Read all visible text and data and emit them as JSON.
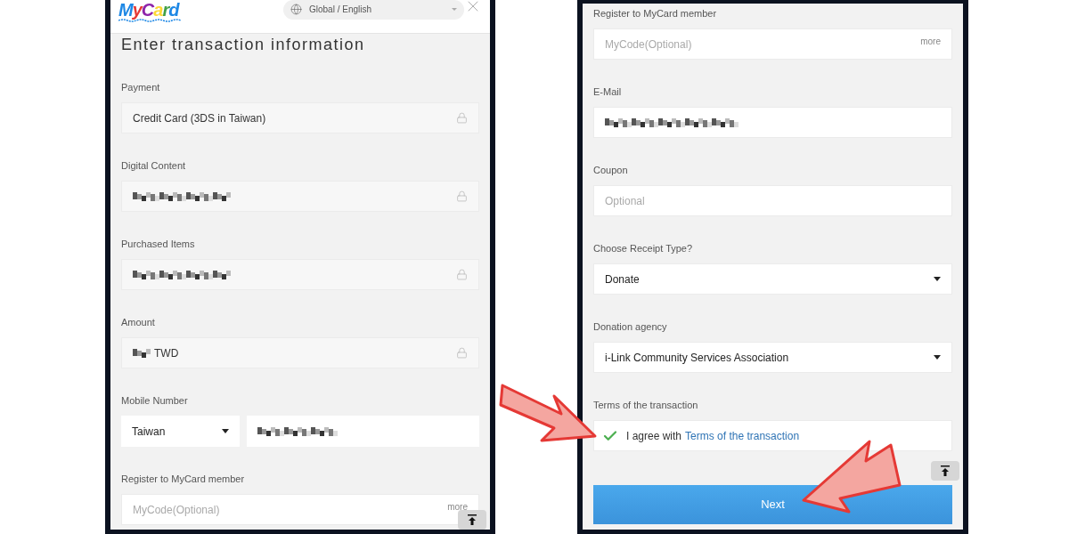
{
  "left_screen": {
    "logo": "MyCard",
    "language": "Global / English",
    "title": "Enter transaction information",
    "fields": [
      {
        "label": "Payment",
        "kind": "locked",
        "value": "Credit Card (3DS in Taiwan)"
      },
      {
        "label": "Digital Content",
        "kind": "locked",
        "redacted": true
      },
      {
        "label": "Purchased Items",
        "kind": "locked",
        "redacted": true
      },
      {
        "label": "Amount",
        "kind": "locked",
        "redacted": true,
        "value": "TWD"
      },
      {
        "label": "Mobile Number",
        "kind": "phone",
        "country": "Taiwan",
        "redacted": true
      },
      {
        "label": "Register to MyCard member",
        "kind": "code",
        "placeholder": "MyCode(Optional)",
        "action": "more"
      }
    ]
  },
  "right_screen": {
    "fields": [
      {
        "label": "Register to MyCard member",
        "kind": "code",
        "placeholder": "MyCode(Optional)",
        "action": "more"
      },
      {
        "label": "E-Mail",
        "kind": "text",
        "redacted": true
      },
      {
        "label": "Coupon",
        "kind": "text",
        "placeholder": "Optional"
      },
      {
        "label": "Choose Receipt Type?",
        "kind": "select",
        "value": "Donate"
      },
      {
        "label": "Donation agency",
        "kind": "select",
        "value": "i-Link Community Services Association"
      },
      {
        "label": "Terms of the transaction",
        "kind": "terms",
        "checked": true,
        "text": "I agree with",
        "link": "Terms of the transaction"
      }
    ],
    "next_button": "Next"
  }
}
